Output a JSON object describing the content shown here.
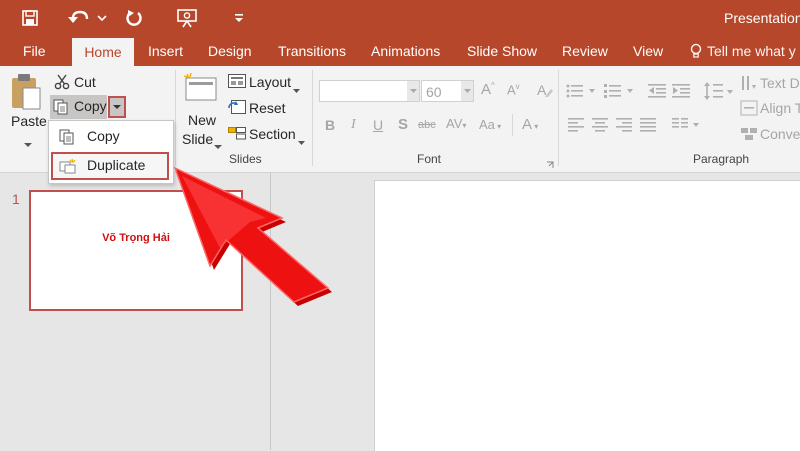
{
  "window": {
    "title": "Presentation"
  },
  "qat": {
    "save_icon": "save-icon",
    "undo_icon": "undo-icon",
    "redo_icon": "redo-icon",
    "presentation_icon": "presentation-icon",
    "customize_icon": "customize-icon"
  },
  "tabs": [
    {
      "label": "File"
    },
    {
      "label": "Home"
    },
    {
      "label": "Insert"
    },
    {
      "label": "Design"
    },
    {
      "label": "Transitions"
    },
    {
      "label": "Animations"
    },
    {
      "label": "Slide Show"
    },
    {
      "label": "Review"
    },
    {
      "label": "View"
    }
  ],
  "tellme": {
    "placeholder": "Tell me what y"
  },
  "clipboard": {
    "paste": "Paste",
    "cut": "Cut",
    "copy": "Copy"
  },
  "slides": {
    "new_slide_line1": "New",
    "new_slide_line2": "Slide",
    "layout": "Layout",
    "reset": "Reset",
    "section": "Section",
    "group_label": "Slides"
  },
  "font": {
    "size": "60",
    "group_label": "Font"
  },
  "paragraph": {
    "text_direction": "Text D",
    "align_text": "Align T",
    "convert": "Conver",
    "group_label": "Paragraph"
  },
  "copy_menu": {
    "copy": "Copy",
    "duplicate": "Duplicate"
  },
  "thumbnails": [
    {
      "number": "1",
      "text": "Võ Trọng Hải"
    }
  ],
  "colors": {
    "accent": "#b7472a",
    "highlight": "#c0504d",
    "arrow": "#e00000"
  }
}
